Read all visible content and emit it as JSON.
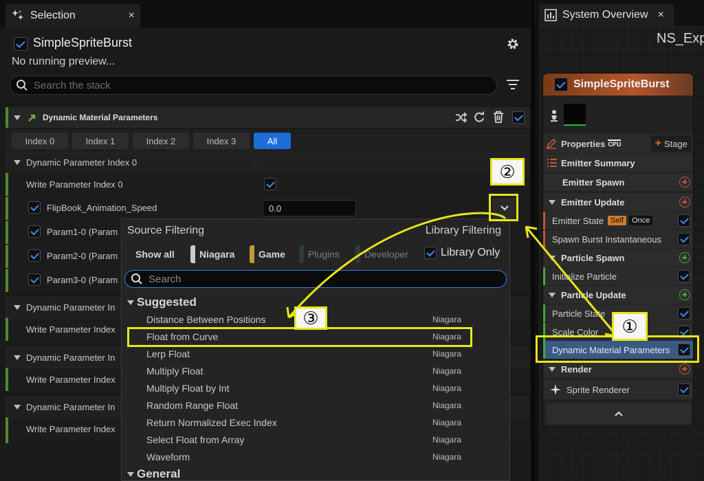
{
  "selection_tab": {
    "title": "Selection",
    "close": "×"
  },
  "emitter": {
    "name": "SimpleSpriteBurst",
    "status": "No running preview..."
  },
  "stack_search": {
    "placeholder": "Search the stack"
  },
  "module": {
    "title": "Dynamic Material Parameters",
    "index_tabs": [
      "Index 0",
      "Index 1",
      "Index 2",
      "Index 3",
      "All"
    ],
    "active_tab": "All",
    "group0": "Dynamic Parameter Index 0",
    "write_label": "Write Parameter Index 0",
    "params": [
      {
        "label": "FlipBook_Animation_Speed",
        "value": "0.0"
      },
      {
        "label": "Param1-0 (Param"
      },
      {
        "label": "Param2-0 (Param"
      },
      {
        "label": "Param3-0 (Param"
      }
    ],
    "more_groups": [
      {
        "title": "Dynamic Parameter In",
        "write": "Write Parameter Index"
      },
      {
        "title": "Dynamic Parameter In",
        "write": "Write Parameter Index"
      },
      {
        "title": "Dynamic Parameter In",
        "write": "Write Parameter Index"
      }
    ]
  },
  "popup": {
    "source_filtering": "Source Filtering",
    "library_filtering": "Library Filtering",
    "chips": [
      {
        "label": "Show all",
        "color": ""
      },
      {
        "label": "Niagara",
        "color": "#c9c9c9"
      },
      {
        "label": "Game",
        "color": "#c39a3a"
      },
      {
        "label": "Plugins",
        "color": "#2e3b38"
      },
      {
        "label": "Developer",
        "color": "#2e3b38"
      }
    ],
    "library_only": "Library Only",
    "search_placeholder": "Search",
    "suggested": "Suggested",
    "items": [
      {
        "name": "Distance Between Positions",
        "source": "Niagara"
      },
      {
        "name": "Float from Curve",
        "source": "Niagara"
      },
      {
        "name": "Lerp Float",
        "source": "Niagara"
      },
      {
        "name": "Multiply Float",
        "source": "Niagara"
      },
      {
        "name": "Multiply Float by Int",
        "source": "Niagara"
      },
      {
        "name": "Random Range Float",
        "source": "Niagara"
      },
      {
        "name": "Return Normalized Exec Index",
        "source": "Niagara"
      },
      {
        "name": "Select Float from Array",
        "source": "Niagara"
      },
      {
        "name": "Waveform",
        "source": "Niagara"
      }
    ],
    "general": "General"
  },
  "overview": {
    "tab_title": "System Overview",
    "close": "×",
    "system_name": "NS_Exp",
    "node_title": "SimpleSpriteBurst",
    "properties": "Properties",
    "cpu": "CPU",
    "stage": "Stage",
    "emitter_summary": "Emitter Summary",
    "emitter_spawn": "Emitter Spawn",
    "emitter_update": "Emitter Update",
    "emitter_state": "Emitter State",
    "self_tag": "Self",
    "once_tag": "Once",
    "spawn_burst": "Spawn Burst Instantaneous",
    "particle_spawn": "Particle Spawn",
    "initialize_particle": "Initialize Particle",
    "particle_update": "Particle Update",
    "particle_state": "Particle State",
    "scale_color": "Scale Color",
    "dmp": "Dynamic Material Parameters",
    "render": "Render",
    "sprite_renderer": "Sprite Renderer"
  },
  "annotations": {
    "one": "①",
    "two": "②",
    "three": "③"
  },
  "colors": {
    "accent": "#1a6ed8",
    "highlight": "#e8e619",
    "stack_green": "#4f8a32",
    "node_orange": "#b4562a"
  }
}
